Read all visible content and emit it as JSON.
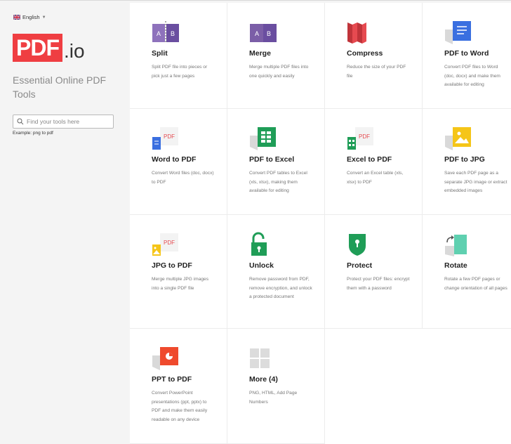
{
  "language": {
    "label": "English"
  },
  "logo": {
    "box_text": "PDF",
    "suffix": ".io"
  },
  "tagline": "Essential Online PDF Tools",
  "search": {
    "placeholder": "Find your tools here"
  },
  "example": {
    "prefix": "Example:",
    "link": "png to pdf"
  },
  "colors": {
    "brand": "#ef3e42",
    "sidebar_bg": "#f4f4f4",
    "split": "#7b5ea7",
    "compress": "#e64a50",
    "word": "#3a6fe0",
    "excel": "#1f9d57",
    "jpg": "#f5c518",
    "unlock": "#1f9d57",
    "protect": "#1f9d57",
    "rotate": "#5fd0b0",
    "ppt": "#ef4a2d"
  },
  "tools": [
    {
      "name": "Split",
      "icon": "split-icon",
      "desc": "Split PDF file into pieces or pick just a few pages"
    },
    {
      "name": "Merge",
      "icon": "merge-icon",
      "desc": "Merge multiple PDF files into one quickly and easily"
    },
    {
      "name": "Compress",
      "icon": "compress-icon",
      "desc": "Reduce the size of your PDF file"
    },
    {
      "name": "PDF to Word",
      "icon": "word-doc-icon",
      "desc": "Convert PDF files to Word (doc, docx) and make them available for editing"
    },
    {
      "name": "Word to PDF",
      "icon": "word-to-pdf-icon",
      "desc": "Convert Word files (doc, docx) to PDF"
    },
    {
      "name": "PDF to Excel",
      "icon": "excel-sheet-icon",
      "desc": "Convert PDF tables to Excel (xls, xlsx), making them available for editing"
    },
    {
      "name": "Excel to PDF",
      "icon": "excel-to-pdf-icon",
      "desc": "Convert an Excel table (xls, xlsx) to PDF"
    },
    {
      "name": "PDF to JPG",
      "icon": "image-icon",
      "desc": "Save each PDF page as a separate JPG image or extract embedded images"
    },
    {
      "name": "JPG to PDF",
      "icon": "jpg-to-pdf-icon",
      "desc": "Merge multiple JPG images into a single PDF file"
    },
    {
      "name": "Unlock",
      "icon": "unlock-icon",
      "desc": "Remove password from PDF, remove encryption, and unlock a protected document"
    },
    {
      "name": "Protect",
      "icon": "shield-lock-icon",
      "desc": "Protect your PDF files: encrypt them with a password"
    },
    {
      "name": "Rotate",
      "icon": "rotate-icon",
      "desc": "Rotate a few PDF pages or change orientation of all pages"
    },
    {
      "name": "PPT to PDF",
      "icon": "ppt-icon",
      "desc": "Convert PowerPoint presentations (ppt, pptx) to PDF and make them easily readable on any device"
    },
    {
      "name": "More (4)",
      "icon": "more-grid-icon",
      "desc": "PNG, HTML, Add Page Numbers"
    }
  ]
}
